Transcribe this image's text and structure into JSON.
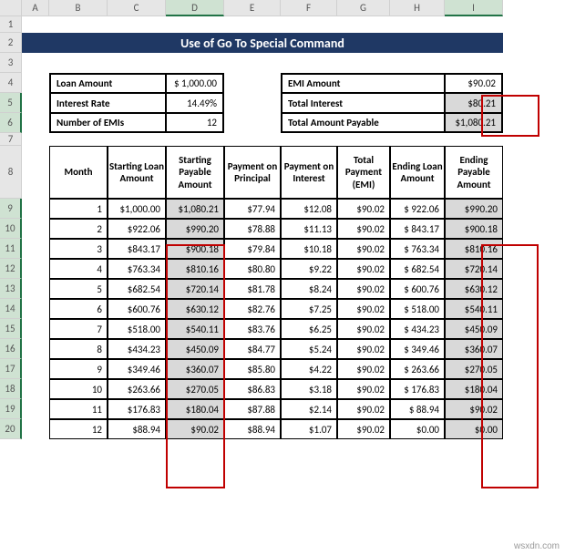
{
  "columns": [
    "A",
    "B",
    "C",
    "D",
    "E",
    "F",
    "G",
    "H",
    "I"
  ],
  "rows": [
    1,
    2,
    3,
    4,
    5,
    6,
    7,
    8,
    9,
    10,
    11,
    12,
    13,
    14,
    15,
    16,
    17,
    18,
    19,
    20
  ],
  "banner": "Use of Go To Special Command",
  "left_box": [
    {
      "label": "Loan Amount",
      "value": "$ 1,000.00"
    },
    {
      "label": "Interest Rate",
      "value": "14.49%"
    },
    {
      "label": "Number of EMIs",
      "value": "12"
    }
  ],
  "right_box": [
    {
      "label": "EMI Amount",
      "value": "$90.02"
    },
    {
      "label": "Total Interest",
      "value": "$80.21"
    },
    {
      "label": "Total Amount Payable",
      "value": "$1,080.21"
    }
  ],
  "headers": [
    "Month",
    "Starting Loan Amount",
    "Starting Payable Amount",
    "Payment on Principal",
    "Payment on Interest",
    "Total Payment (EMI)",
    "Ending Loan Amount",
    "Ending Payable Amount"
  ],
  "chart_data": {
    "type": "table",
    "columns": [
      "Month",
      "Starting Loan Amount",
      "Starting Payable Amount",
      "Payment on Principal",
      "Payment on Interest",
      "Total Payment (EMI)",
      "Ending Loan Amount",
      "Ending Payable Amount"
    ],
    "rows": [
      [
        1,
        "$1,000.00",
        "$1,080.21",
        "$77.94",
        "$12.08",
        "$90.02",
        "$ 922.06",
        "$990.20"
      ],
      [
        2,
        "$922.06",
        "$990.20",
        "$78.88",
        "$11.13",
        "$90.02",
        "$ 843.17",
        "$900.18"
      ],
      [
        3,
        "$843.17",
        "$900.18",
        "$79.84",
        "$10.18",
        "$90.02",
        "$ 763.34",
        "$810.16"
      ],
      [
        4,
        "$763.34",
        "$810.16",
        "$80.80",
        "$9.22",
        "$90.02",
        "$ 682.54",
        "$720.14"
      ],
      [
        5,
        "$682.54",
        "$720.14",
        "$81.78",
        "$8.24",
        "$90.02",
        "$ 600.76",
        "$630.12"
      ],
      [
        6,
        "$600.76",
        "$630.12",
        "$82.76",
        "$7.25",
        "$90.02",
        "$ 518.00",
        "$540.11"
      ],
      [
        7,
        "$518.00",
        "$540.11",
        "$83.76",
        "$6.25",
        "$90.02",
        "$ 434.23",
        "$450.09"
      ],
      [
        8,
        "$434.23",
        "$450.09",
        "$84.77",
        "$5.24",
        "$90.02",
        "$ 349.46",
        "$360.07"
      ],
      [
        9,
        "$349.46",
        "$360.07",
        "$85.80",
        "$4.22",
        "$90.02",
        "$ 263.66",
        "$270.05"
      ],
      [
        10,
        "$263.66",
        "$270.05",
        "$86.83",
        "$3.18",
        "$90.02",
        "$ 176.83",
        "$180.04"
      ],
      [
        11,
        "$176.83",
        "$180.04",
        "$87.88",
        "$2.14",
        "$90.02",
        "$  88.94",
        "$90.02"
      ],
      [
        12,
        "$88.94",
        "$90.02",
        "$88.94",
        "$1.07",
        "$90.02",
        "$0.00",
        "$0.00"
      ]
    ]
  },
  "watermark": "wsxdn.com"
}
